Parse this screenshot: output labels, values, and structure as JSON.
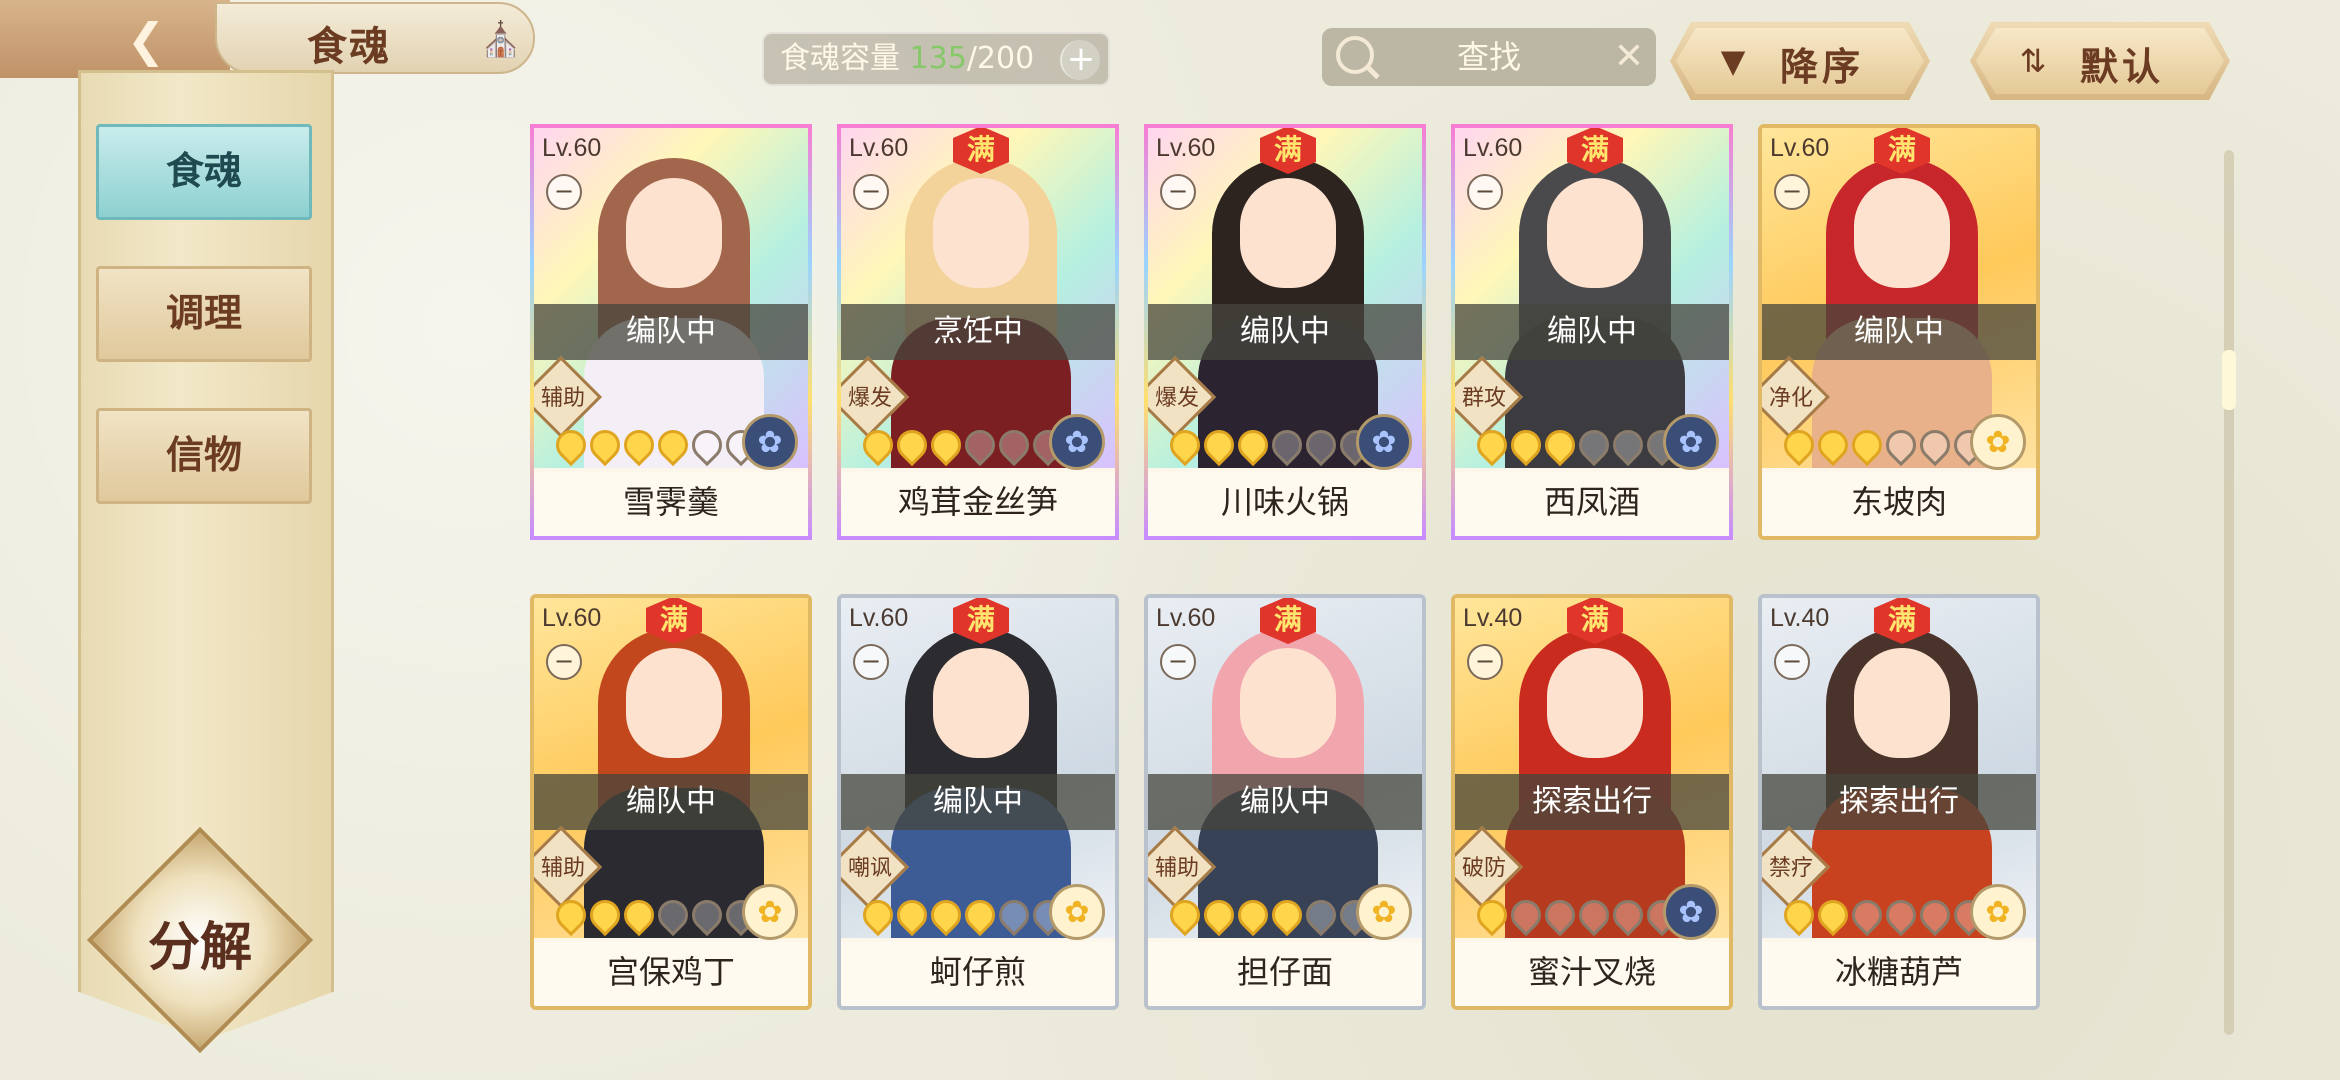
{
  "header": {
    "back_icon": "back-arrow-icon",
    "title": "食魂",
    "home_icon": "home-pavilion-icon",
    "capacity_label": "食魂容量",
    "capacity_current": "135",
    "capacity_max": "/200",
    "search_placeholder": "查找",
    "sort_order_label": "降序",
    "sort_mode_label": "默认"
  },
  "sidebar": {
    "tabs": [
      {
        "label": "食魂",
        "active": true
      },
      {
        "label": "调理",
        "active": false
      },
      {
        "label": "信物",
        "active": false
      }
    ],
    "decompose_label": "分解"
  },
  "cards": [
    {
      "level": "Lv.60",
      "max": "",
      "status": "编队中",
      "role": "辅助",
      "stars": 4,
      "element": "blue",
      "name": "雪霁羹",
      "frame": "rainbow",
      "hair": "#a2664c",
      "body": "#f4eef6"
    },
    {
      "level": "Lv.60",
      "max": "满",
      "status": "烹饪中",
      "role": "爆发",
      "stars": 3,
      "element": "blue",
      "name": "鸡茸金丝笋",
      "frame": "rainbow",
      "hair": "#f3d39a",
      "body": "#7c1f22"
    },
    {
      "level": "Lv.60",
      "max": "满",
      "status": "编队中",
      "role": "爆发",
      "stars": 3,
      "element": "blue",
      "name": "川味火锅",
      "frame": "rainbow",
      "hair": "#2d2420",
      "body": "#2b2430"
    },
    {
      "level": "Lv.60",
      "max": "满",
      "status": "编队中",
      "role": "群攻",
      "stars": 3,
      "element": "blue",
      "name": "西凤酒",
      "frame": "rainbow",
      "hair": "#4a4a4c",
      "body": "#3b3b40"
    },
    {
      "level": "Lv.60",
      "max": "满",
      "status": "编队中",
      "role": "净化",
      "stars": 3,
      "element": "gold",
      "name": "东坡肉",
      "frame": "gold",
      "hair": "#c7262b",
      "body": "#e9b18a"
    },
    {
      "level": "Lv.60",
      "max": "满",
      "status": "编队中",
      "role": "辅助",
      "stars": 3,
      "element": "gold",
      "name": "宫保鸡丁",
      "frame": "gold",
      "hair": "#c2471c",
      "body": "#2a2a30"
    },
    {
      "level": "Lv.60",
      "max": "满",
      "status": "编队中",
      "role": "嘲讽",
      "stars": 4,
      "element": "gold",
      "name": "蚵仔煎",
      "frame": "silver",
      "hair": "#2b2b30",
      "body": "#3d5c96"
    },
    {
      "level": "Lv.60",
      "max": "满",
      "status": "编队中",
      "role": "辅助",
      "stars": 4,
      "element": "gold",
      "name": "担仔面",
      "frame": "silver",
      "hair": "#f1a6ae",
      "body": "#384257"
    },
    {
      "level": "Lv.40",
      "max": "满",
      "status": "探索出行",
      "role": "破防",
      "stars": 1,
      "element": "blue",
      "name": "蜜汁叉烧",
      "frame": "gold",
      "hair": "#c92b1e",
      "body": "#b63b1e"
    },
    {
      "level": "Lv.40",
      "max": "满",
      "status": "探索出行",
      "role": "禁疗",
      "stars": 2,
      "element": "gold",
      "name": "冰糖葫芦",
      "frame": "silver",
      "hair": "#4a332a",
      "body": "#c9421f"
    }
  ]
}
